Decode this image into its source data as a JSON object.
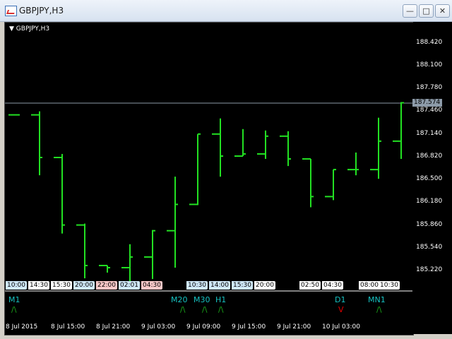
{
  "window": {
    "title": "GBPJPY,H3",
    "buttons": [
      "—",
      "□",
      "✕"
    ]
  },
  "chart": {
    "symbol_label": "GBPJPY,H3",
    "price_levels": [
      "188.420",
      "188.100",
      "187.780",
      "187.460",
      "187.140",
      "186.820",
      "186.500",
      "186.180",
      "185.860",
      "185.540",
      "185.220"
    ],
    "current_price": "187.574",
    "time_labels": [
      "8 Jul 2015",
      "8 Jul 15:00",
      "8 Jul 21:00",
      "9 Jul 03:00",
      "9 Jul 09:00",
      "9 Jul 15:00",
      "9 Jul 21:00",
      "10 Jul 03:00"
    ],
    "session_labels": [
      "10:00",
      "14:30",
      "15:30",
      "20:00",
      "22:00",
      "02:01",
      "04:30",
      "10:30",
      "14:00",
      "15:30",
      "20:00",
      "02:50",
      "04:30",
      "08:00",
      "10:30"
    ],
    "timeframes": [
      {
        "label": "M1",
        "arrow": "/\\",
        "color": "#1aa51a"
      },
      {
        "label": "M20",
        "arrow": "/\\",
        "color": "#1aa51a"
      },
      {
        "label": "M30",
        "arrow": "/\\",
        "color": "#1aa51a"
      },
      {
        "label": "H1",
        "arrow": "/\\",
        "color": "#1aa51a"
      },
      {
        "label": "D1",
        "arrow": "V",
        "color": "#e00000"
      },
      {
        "label": "MN1",
        "arrow": "/\\",
        "color": "#1aa51a"
      }
    ],
    "colors": {
      "bar": "#22e022",
      "background": "#000000",
      "price_line": "#8c9aa8"
    }
  },
  "chart_data": {
    "type": "ohlc",
    "bars": [
      {
        "open": 187.4,
        "high": 187.4,
        "low": 187.4,
        "close": 187.4
      },
      {
        "open": 187.4,
        "high": 187.45,
        "low": 186.55,
        "close": 186.8
      },
      {
        "open": 186.8,
        "high": 186.85,
        "low": 185.73,
        "close": 185.85
      },
      {
        "open": 185.85,
        "high": 185.87,
        "low": 185.1,
        "close": 185.28
      },
      {
        "open": 185.28,
        "high": 185.28,
        "low": 185.18,
        "close": 185.25
      },
      {
        "open": 185.25,
        "high": 185.58,
        "low": 185.02,
        "close": 185.4
      },
      {
        "open": 185.4,
        "high": 185.78,
        "low": 185.09,
        "close": 185.77
      },
      {
        "open": 185.77,
        "high": 186.53,
        "low": 185.25,
        "close": 186.14
      },
      {
        "open": 186.14,
        "high": 187.13,
        "low": 186.13,
        "close": 187.13
      },
      {
        "open": 187.13,
        "high": 187.35,
        "low": 186.53,
        "close": 186.82
      },
      {
        "open": 186.82,
        "high": 187.2,
        "low": 186.82,
        "close": 186.85
      },
      {
        "open": 186.85,
        "high": 187.18,
        "low": 186.78,
        "close": 187.1
      },
      {
        "open": 187.1,
        "high": 187.17,
        "low": 186.68,
        "close": 186.78
      },
      {
        "open": 186.78,
        "high": 186.78,
        "low": 186.1,
        "close": 186.25
      },
      {
        "open": 186.25,
        "high": 186.63,
        "low": 186.2,
        "close": 186.63
      },
      {
        "open": 186.63,
        "high": 186.87,
        "low": 186.55,
        "close": 186.63
      },
      {
        "open": 186.63,
        "high": 187.36,
        "low": 186.5,
        "close": 187.03
      },
      {
        "open": 187.03,
        "high": 187.58,
        "low": 186.78,
        "close": 187.57
      }
    ]
  }
}
